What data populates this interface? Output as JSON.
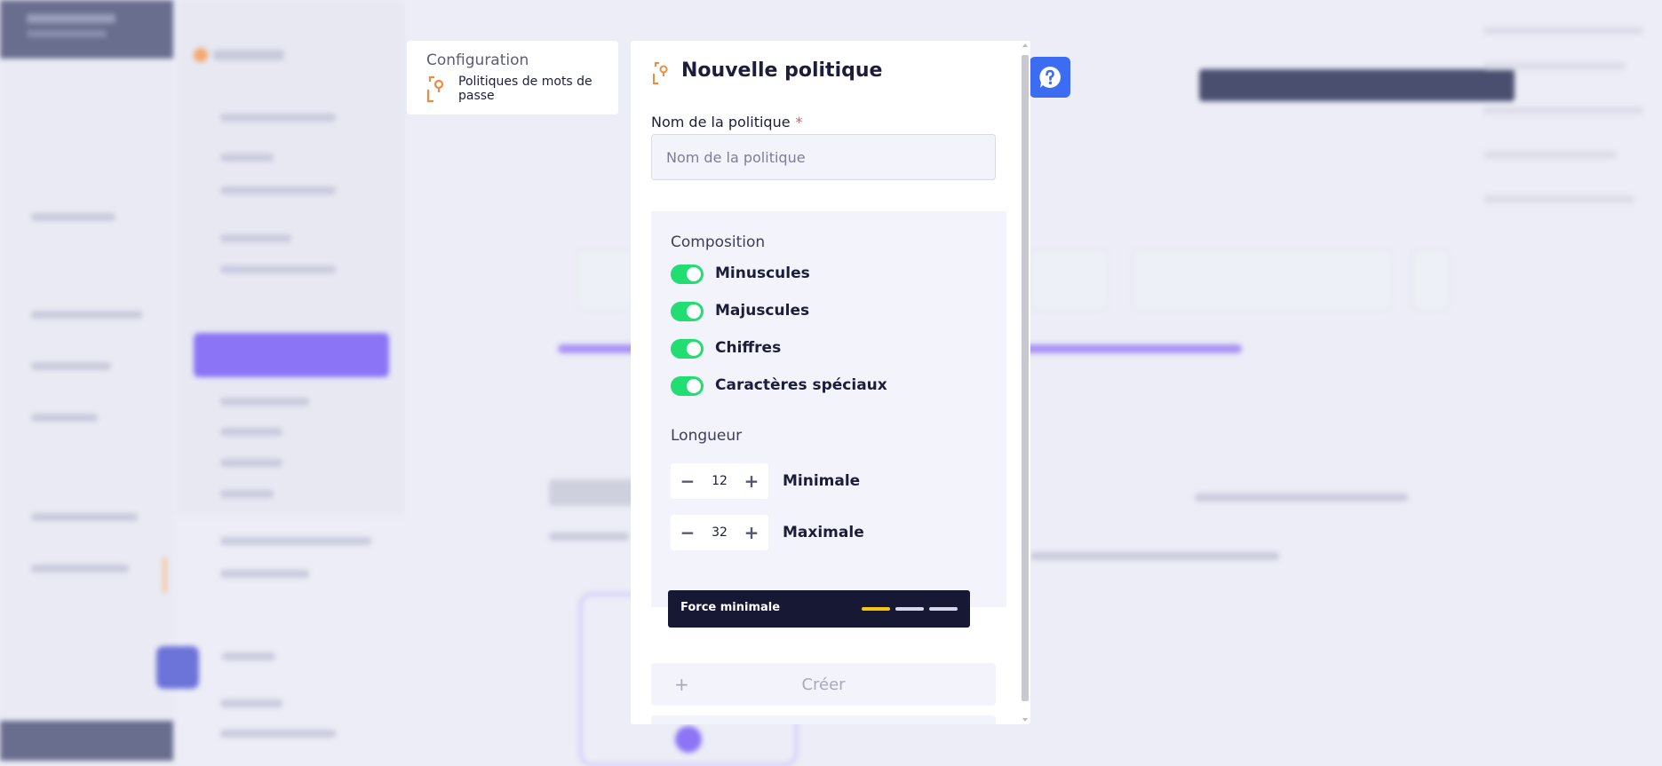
{
  "breadcrumb": {
    "section": "Configuration",
    "item": "Politiques de mots de passe"
  },
  "modal": {
    "title": "Nouvelle politique",
    "name_field": {
      "label": "Nom de la politique",
      "required_mark": "*",
      "placeholder": "Nom de la politique",
      "value": ""
    },
    "composition": {
      "title": "Composition",
      "toggles": [
        {
          "label": "Minuscules",
          "on": true
        },
        {
          "label": "Majuscules",
          "on": true
        },
        {
          "label": "Chiffres",
          "on": true
        },
        {
          "label": "Caractères spéciaux",
          "on": true
        }
      ]
    },
    "length": {
      "title": "Longueur",
      "min": {
        "value": "12",
        "label": "Minimale"
      },
      "max": {
        "value": "32",
        "label": "Maximale"
      },
      "minus_symbol": "−",
      "plus_symbol": "+"
    },
    "strength": {
      "label": "Force minimale",
      "levels_total": 3,
      "levels_active": 1,
      "active_color": "#f5c518",
      "inactive_color": "#d7d8ee"
    },
    "create_button": {
      "icon": "+",
      "label": "Créer"
    }
  },
  "help_button": {
    "icon": "help-icon"
  },
  "colors": {
    "toggle_on": "#21dd72",
    "help_blue": "#3c6cf2",
    "accent_orange": "#f08a3c",
    "strength_bg": "#171834"
  }
}
